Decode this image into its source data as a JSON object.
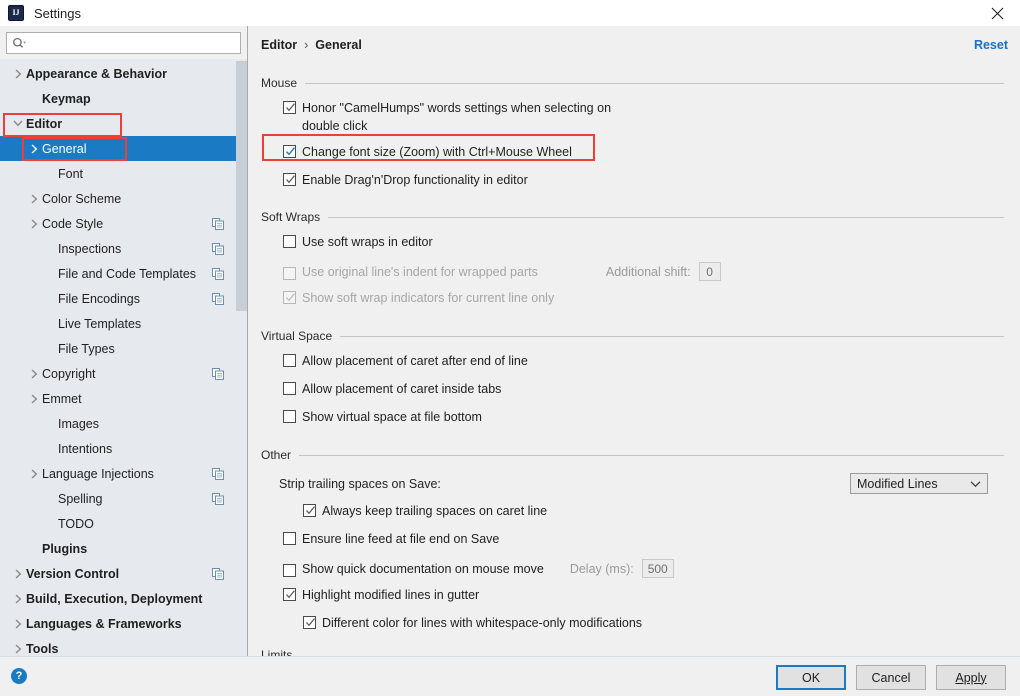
{
  "window": {
    "title": "Settings",
    "logo_text": "IJ",
    "close_icon": "close-icon"
  },
  "search": {
    "value": "",
    "placeholder": "",
    "icon": "search-icon"
  },
  "sidebar": {
    "items": [
      {
        "label": "Appearance & Behavior",
        "level": 0,
        "bold": true,
        "arrow": "right",
        "config_icon": false,
        "selected": false
      },
      {
        "label": "Keymap",
        "level": 1,
        "bold": true,
        "arrow": "none",
        "config_icon": false,
        "selected": false
      },
      {
        "label": "Editor",
        "level": 0,
        "bold": true,
        "arrow": "down",
        "config_icon": false,
        "selected": false
      },
      {
        "label": "General",
        "level": 1,
        "bold": false,
        "arrow": "right",
        "config_icon": false,
        "selected": true
      },
      {
        "label": "Font",
        "level": 2,
        "bold": false,
        "arrow": "none",
        "config_icon": false,
        "selected": false
      },
      {
        "label": "Color Scheme",
        "level": 1,
        "bold": false,
        "arrow": "right",
        "config_icon": false,
        "selected": false
      },
      {
        "label": "Code Style",
        "level": 1,
        "bold": false,
        "arrow": "right",
        "config_icon": true,
        "selected": false
      },
      {
        "label": "Inspections",
        "level": 2,
        "bold": false,
        "arrow": "none",
        "config_icon": true,
        "selected": false
      },
      {
        "label": "File and Code Templates",
        "level": 2,
        "bold": false,
        "arrow": "none",
        "config_icon": true,
        "selected": false
      },
      {
        "label": "File Encodings",
        "level": 2,
        "bold": false,
        "arrow": "none",
        "config_icon": true,
        "selected": false
      },
      {
        "label": "Live Templates",
        "level": 2,
        "bold": false,
        "arrow": "none",
        "config_icon": false,
        "selected": false
      },
      {
        "label": "File Types",
        "level": 2,
        "bold": false,
        "arrow": "none",
        "config_icon": false,
        "selected": false
      },
      {
        "label": "Copyright",
        "level": 1,
        "bold": false,
        "arrow": "right",
        "config_icon": true,
        "selected": false
      },
      {
        "label": "Emmet",
        "level": 1,
        "bold": false,
        "arrow": "right",
        "config_icon": false,
        "selected": false
      },
      {
        "label": "Images",
        "level": 2,
        "bold": false,
        "arrow": "none",
        "config_icon": false,
        "selected": false
      },
      {
        "label": "Intentions",
        "level": 2,
        "bold": false,
        "arrow": "none",
        "config_icon": false,
        "selected": false
      },
      {
        "label": "Language Injections",
        "level": 1,
        "bold": false,
        "arrow": "right",
        "config_icon": true,
        "selected": false
      },
      {
        "label": "Spelling",
        "level": 2,
        "bold": false,
        "arrow": "none",
        "config_icon": true,
        "selected": false
      },
      {
        "label": "TODO",
        "level": 2,
        "bold": false,
        "arrow": "none",
        "config_icon": false,
        "selected": false
      },
      {
        "label": "Plugins",
        "level": 1,
        "bold": true,
        "arrow": "none",
        "config_icon": false,
        "selected": false
      },
      {
        "label": "Version Control",
        "level": 0,
        "bold": true,
        "arrow": "right",
        "config_icon": true,
        "selected": false
      },
      {
        "label": "Build, Execution, Deployment",
        "level": 0,
        "bold": true,
        "arrow": "right",
        "config_icon": false,
        "selected": false
      },
      {
        "label": "Languages & Frameworks",
        "level": 0,
        "bold": true,
        "arrow": "right",
        "config_icon": false,
        "selected": false
      },
      {
        "label": "Tools",
        "level": 0,
        "bold": true,
        "arrow": "right",
        "config_icon": false,
        "selected": false
      }
    ]
  },
  "main": {
    "breadcrumb": {
      "parent": "Editor",
      "separator": "›",
      "current": "General"
    },
    "reset_label": "Reset",
    "sections": {
      "mouse": {
        "title": "Mouse",
        "options": [
          {
            "label": "Honor \"CamelHumps\" words settings when selecting on double click",
            "checked": true,
            "disabled": false,
            "highlighted": false,
            "accent": false
          },
          {
            "label": "Change font size (Zoom) with Ctrl+Mouse Wheel",
            "checked": true,
            "disabled": false,
            "highlighted": true,
            "accent": true
          },
          {
            "label": "Enable Drag'n'Drop functionality in editor",
            "checked": true,
            "disabled": false,
            "highlighted": false,
            "accent": false
          }
        ]
      },
      "soft_wraps": {
        "title": "Soft Wraps",
        "options": [
          {
            "label": "Use soft wraps in editor",
            "checked": false,
            "disabled": false
          },
          {
            "label": "Use original line's indent for wrapped parts",
            "checked": false,
            "disabled": true
          },
          {
            "label": "Show soft wrap indicators for current line only",
            "checked": true,
            "disabled": true
          }
        ],
        "additional_shift": {
          "label": "Additional shift:",
          "value": "0"
        }
      },
      "virtual_space": {
        "title": "Virtual Space",
        "options": [
          {
            "label": "Allow placement of caret after end of line",
            "checked": false,
            "disabled": false
          },
          {
            "label": "Allow placement of caret inside tabs",
            "checked": false,
            "disabled": false
          },
          {
            "label": "Show virtual space at file bottom",
            "checked": false,
            "disabled": false
          }
        ]
      },
      "other": {
        "title": "Other",
        "strip_trailing_label": "Strip trailing spaces on Save:",
        "strip_trailing_value": "Modified Lines",
        "options": [
          {
            "label": "Always keep trailing spaces on caret line",
            "checked": true,
            "indent": true
          },
          {
            "label": "Ensure line feed at file end on Save",
            "checked": false,
            "indent": false
          },
          {
            "label": "Show quick documentation on mouse move",
            "checked": false,
            "indent": false
          },
          {
            "label": "Highlight modified lines in gutter",
            "checked": true,
            "indent": false
          },
          {
            "label": "Different color for lines with whitespace-only modifications",
            "checked": true,
            "indent": true
          }
        ],
        "delay": {
          "label": "Delay (ms):",
          "value": "500"
        }
      }
    }
  },
  "footer": {
    "help_icon": "?",
    "buttons": {
      "ok": "OK",
      "cancel": "Cancel",
      "apply": "Apply"
    }
  },
  "colors": {
    "selection_blue": "#1a7ac4",
    "link_blue": "#1a71c9",
    "annotation_red": "#ef3e36",
    "accent_check": "#1a7ac4"
  }
}
